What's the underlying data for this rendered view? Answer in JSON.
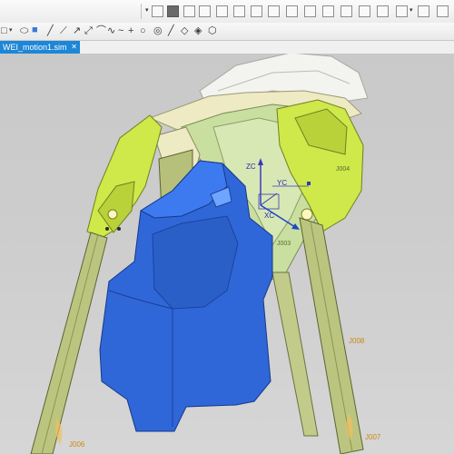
{
  "window": {
    "active_tab": "WEI_motion1.sim"
  },
  "toolbar": {
    "row1": [
      "view-orient-icon",
      "fit-icon",
      "snap-view-icon",
      "zoom-icon",
      "rotate-icon",
      "pan-icon",
      "render-style-icon",
      "wireframe-icon",
      "shaded-icon",
      "section-icon",
      "layer-icon",
      "grid-icon",
      "hide-icon",
      "show-icon",
      "measure-icon",
      "analysis-icon",
      "layout-icon"
    ],
    "row2": [
      "square-icon",
      "cube-icon",
      "line-icon",
      "polyline-icon",
      "arc-icon",
      "spline-icon",
      "point-icon",
      "circle-icon",
      "ring-icon",
      "edit-icon",
      "tool-icon",
      "settings-icon",
      "more-icon"
    ]
  },
  "viewport": {
    "csys": {
      "axis_z": "ZC",
      "axis_y": "YC",
      "axis_x": "XC"
    },
    "joints": [
      "J008",
      "J006",
      "J007"
    ],
    "parts": [
      "J004",
      "J003"
    ],
    "colors": {
      "background": "#cccccc",
      "blue_part": "#2f67d8",
      "lime_part": "#cfe84a",
      "light_green": "#c9dfa0",
      "cream": "#eeeac3",
      "olive_leg": "#bcc580",
      "white_shell": "#f3f3ef"
    }
  }
}
